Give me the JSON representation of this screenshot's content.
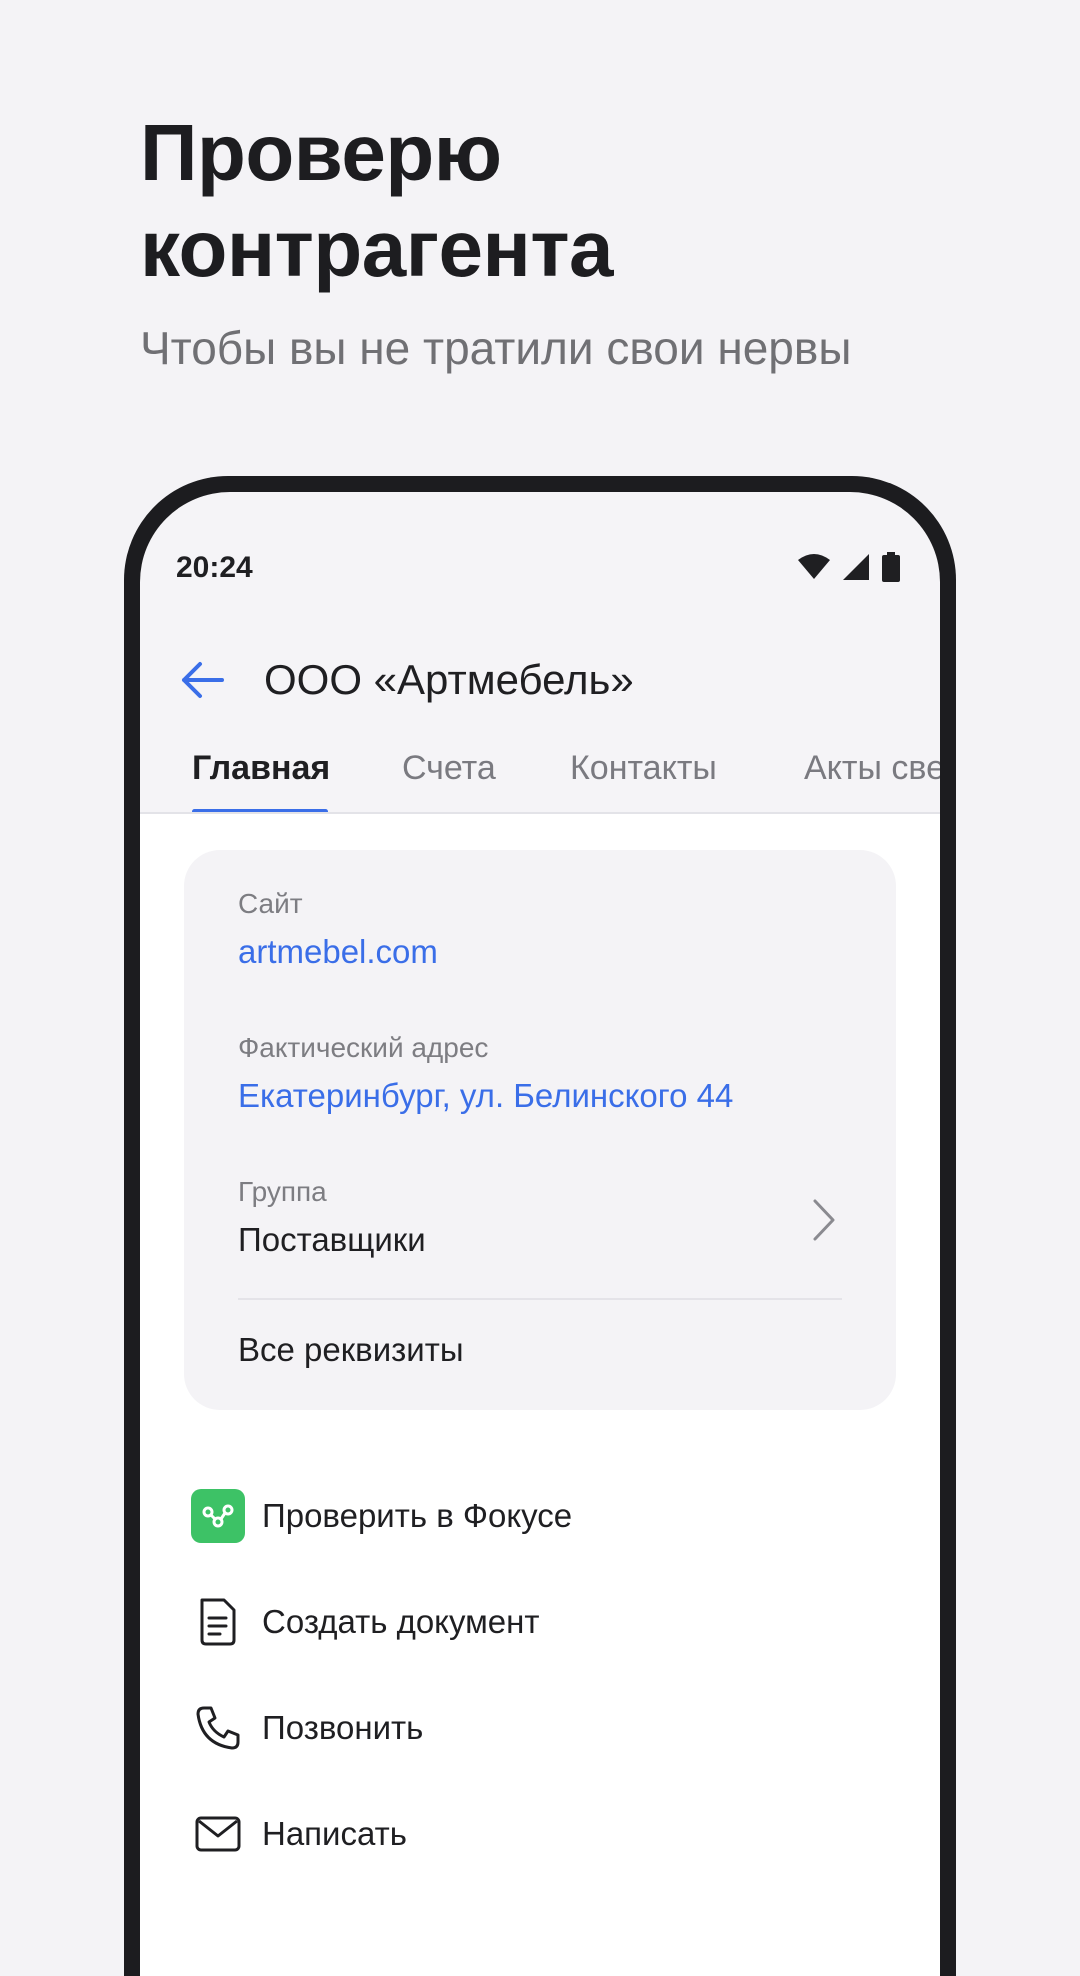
{
  "promo": {
    "title_line1": "Проверю",
    "title_line2": "контрагента",
    "subtitle": "Чтобы вы не тратили свои нервы"
  },
  "status_bar": {
    "time": "20:24",
    "icons": [
      "wifi-icon",
      "signal-icon",
      "battery-icon"
    ]
  },
  "app_bar": {
    "back_icon": "arrow-left-icon",
    "title": "ООО «Артмебель»"
  },
  "tabs": [
    {
      "label": "Главная",
      "active": true
    },
    {
      "label": "Счета",
      "active": false
    },
    {
      "label": "Контакты",
      "active": false
    },
    {
      "label": "Акты сверки",
      "active": false
    }
  ],
  "details": {
    "site_label": "Сайт",
    "site_value": "artmebel.com",
    "address_label": "Фактический адрес",
    "address_value": "Екатеринбург, ул. Белинского 44",
    "group_label": "Группа",
    "group_value": "Поставщики",
    "all_requisites": "Все реквизиты"
  },
  "actions": [
    {
      "label": "Проверить в Фокусе",
      "icon": "focus-logo-icon"
    },
    {
      "label": "Создать документ",
      "icon": "document-icon"
    },
    {
      "label": "Позвонить",
      "icon": "phone-icon"
    },
    {
      "label": "Написать",
      "icon": "mail-icon"
    }
  ],
  "colors": {
    "accent": "#3a6ee8",
    "focus_green": "#3dc266",
    "background": "#f4f3f6",
    "phone_frame": "#1c1c1f"
  }
}
